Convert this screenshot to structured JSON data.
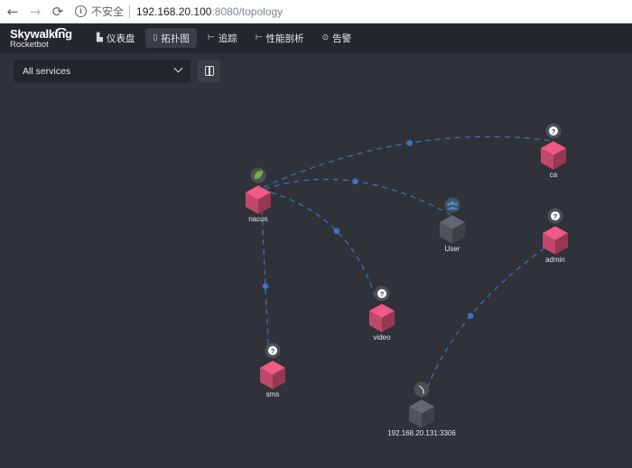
{
  "browser": {
    "back_icon": "arrow-left-icon",
    "forward_icon": "arrow-right-icon",
    "reload_icon": "reload-icon",
    "security_text": "不安全",
    "url_host": "192.168.20.100",
    "url_path": ":8080/topology"
  },
  "app": {
    "logo_text": "Skywalking",
    "logo_sub": "Rocketbot",
    "nav": [
      {
        "label": "仪表盘",
        "icon": "dashboard-icon"
      },
      {
        "label": "拓扑图",
        "icon": "topology-icon",
        "active": true
      },
      {
        "label": "追踪",
        "icon": "trace-icon"
      },
      {
        "label": "性能剖析",
        "icon": "profile-icon"
      },
      {
        "label": "告警",
        "icon": "alarm-icon"
      }
    ]
  },
  "toolbar": {
    "service_select": "All services",
    "layout_button_icon": "layout-icon"
  },
  "topology": {
    "colors": {
      "service": "#c0486a",
      "user": "#4e535c",
      "edge": "#3e74c2",
      "badge": "#4b4f57"
    },
    "nodes": [
      {
        "id": "nacos",
        "label": "nacos",
        "kind": "service",
        "badge": "spring"
      },
      {
        "id": "ca",
        "label": "ca",
        "kind": "service",
        "badge": "unknown"
      },
      {
        "id": "user",
        "label": "User",
        "kind": "user",
        "badge": "user"
      },
      {
        "id": "admin",
        "label": "admin",
        "kind": "service",
        "badge": "unknown"
      },
      {
        "id": "video",
        "label": "video",
        "kind": "service",
        "badge": "unknown"
      },
      {
        "id": "sms",
        "label": "sms",
        "kind": "service",
        "badge": "unknown"
      },
      {
        "id": "db",
        "label": "192.168.20.131:3306",
        "kind": "user",
        "badge": "database"
      }
    ],
    "edges": [
      {
        "from": "nacos",
        "to": "ca"
      },
      {
        "from": "user",
        "to": "nacos"
      },
      {
        "from": "nacos",
        "to": "video"
      },
      {
        "from": "nacos",
        "to": "sms"
      },
      {
        "from": "admin",
        "to": "db"
      }
    ]
  }
}
